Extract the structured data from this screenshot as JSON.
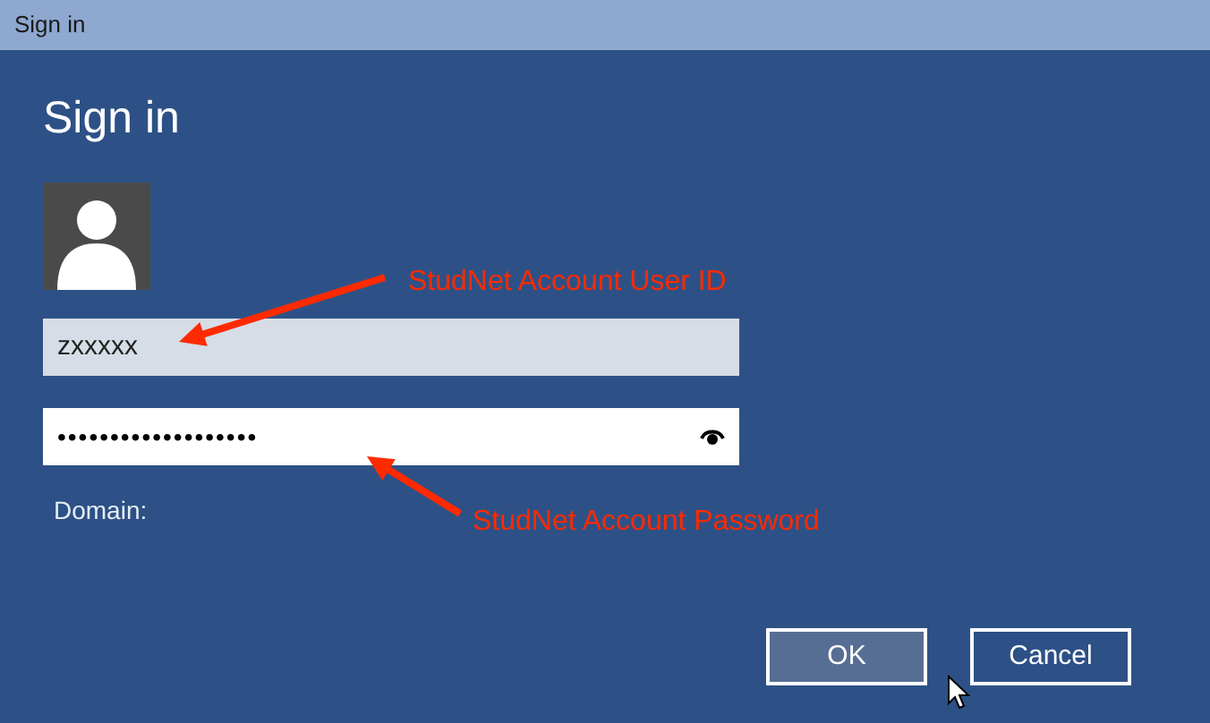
{
  "window": {
    "title": "Sign in"
  },
  "heading": "Sign in",
  "fields": [
    {
      "kind": "text",
      "value": "zxxxxx"
    },
    {
      "kind": "password",
      "value": "•••••••••••••••••••"
    }
  ],
  "domain_label": "Domain:",
  "annotations": [
    {
      "text": "StudNet Account User ID"
    },
    {
      "text": "StudNet Account Password"
    }
  ],
  "buttons": [
    {
      "label": "OK",
      "hovered": true
    },
    {
      "label": "Cancel",
      "hovered": false
    }
  ]
}
